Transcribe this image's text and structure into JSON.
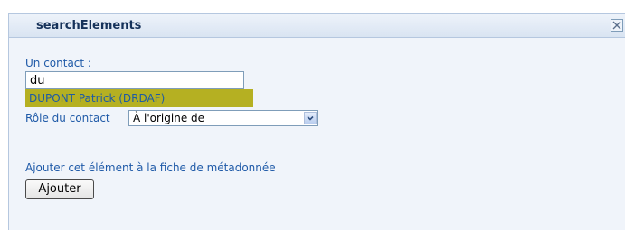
{
  "window": {
    "title": "searchElements",
    "close_icon": "close-icon"
  },
  "form": {
    "contact_label": "Un contact :",
    "contact_value": "du",
    "suggestion": "DUPONT Patrick (DRDAF)",
    "role_label": "Rôle du contact",
    "role_selected": "À l'origine de",
    "add_info": "Ajouter cet élément à la fiche de métadonnée",
    "add_button": "Ajouter"
  },
  "colors": {
    "panel_bg": "#f0f4fa",
    "label_blue": "#1f5aa8",
    "suggestion_highlight": "#b5b022"
  }
}
